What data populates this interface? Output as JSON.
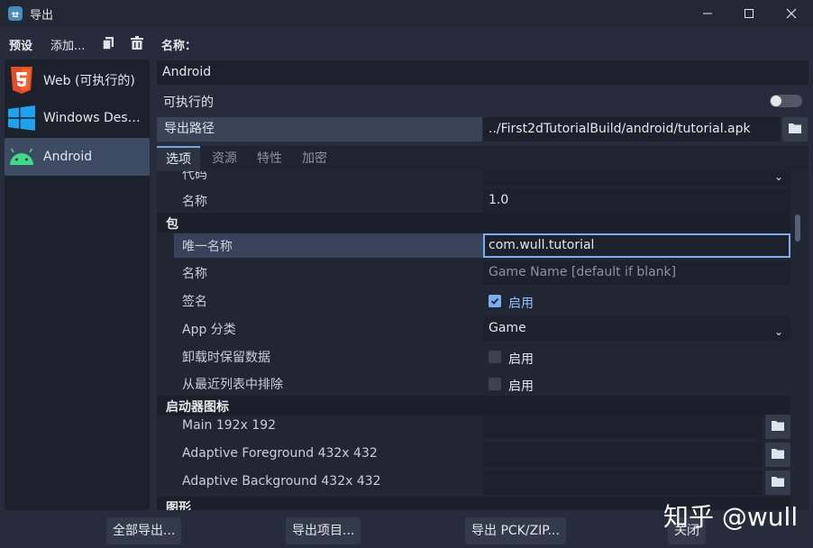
{
  "window": {
    "title": "导出",
    "minimize": "—",
    "maximize": "☐",
    "close": "✕"
  },
  "toolbar": {
    "presets_label": "预设",
    "add_label": "添加...",
    "name_label": "名称："
  },
  "presets": [
    {
      "label": "Web (可执行的)",
      "icon": "html5-icon"
    },
    {
      "label": "Windows Desktop",
      "icon": "windows-icon"
    },
    {
      "label": "Android",
      "icon": "android-icon",
      "selected": true
    }
  ],
  "preset_name": "Android",
  "runnable": {
    "label": "可执行的",
    "on": false
  },
  "export_path": {
    "label": "导出路径",
    "value": "../First2dTutorialBuild/android/tutorial.apk"
  },
  "tabs": [
    "选项",
    "资源",
    "特性",
    "加密"
  ],
  "options": {
    "partial_row_label": "代码",
    "version_name": {
      "label": "名称",
      "value": "1.0"
    },
    "package_section": "包",
    "unique_name": {
      "label": "唯一名称",
      "value": "com.wull.tutorial"
    },
    "pkg_name": {
      "label": "名称",
      "placeholder": "Game Name [default if blank]"
    },
    "signed": {
      "label": "签名",
      "check": "启用",
      "on": true
    },
    "app_category": {
      "label": "App 分类",
      "value": "Game"
    },
    "retain_data": {
      "label": "卸载时保留数据",
      "check": "启用",
      "on": false
    },
    "exclude_recents": {
      "label": "从最近列表中排除",
      "check": "启用",
      "on": false
    },
    "launcher_section": "启动器图标",
    "main_icon": {
      "label": "Main 192x 192"
    },
    "adaptive_fg": {
      "label": "Adaptive Foreground 432x 432"
    },
    "adaptive_bg": {
      "label": "Adaptive Background 432x 432"
    },
    "graphics_section": "图形"
  },
  "buttons": {
    "export_all": "全部导出...",
    "export_project": "导出项目...",
    "export_pck": "导出 PCK/ZIP...",
    "close": "关闭"
  },
  "watermark": "知乎 @wull",
  "colors": {
    "accent": "#7aaef0",
    "panel": "#212633",
    "background": "#262c3b"
  }
}
